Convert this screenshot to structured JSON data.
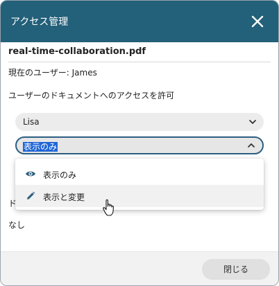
{
  "dialog": {
    "title": "アクセス管理",
    "filename": "real-time-collaboration.pdf",
    "current_user": "現在のユーザー: James",
    "grant_label": "ユーザーのドキュメントへのアクセスを許可"
  },
  "user_select": {
    "value": "Lisa"
  },
  "permission_select": {
    "value": "表示のみ",
    "options": [
      {
        "label": "表示のみ",
        "icon": "eye-icon"
      },
      {
        "label": "表示と変更",
        "icon": "pencil-icon"
      }
    ]
  },
  "permissions_list": {
    "heading_partial": "ド",
    "empty_text": "なし"
  },
  "footer": {
    "close_label": "閉じる"
  },
  "colors": {
    "header": "#236079",
    "focus_border": "#2c5e83",
    "selection": "#1f66d6"
  }
}
